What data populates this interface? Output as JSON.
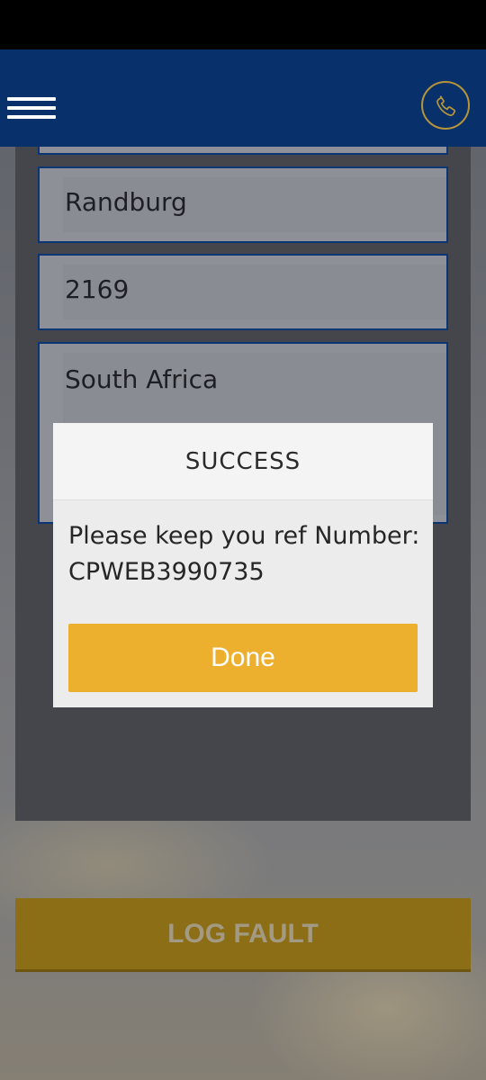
{
  "header": {
    "menu_icon": "hamburger-menu-icon",
    "phone_icon": "phone-icon"
  },
  "form": {
    "city": "Randburg",
    "postal_code": "2169",
    "country": "South Africa"
  },
  "log_fault_label": "LOG FAULT",
  "dialog": {
    "title": "SUCCESS",
    "message_line1": "Please keep you ref Number:",
    "message_line2": "CPWEB3990735",
    "done_label": "Done"
  },
  "colors": {
    "header": "#08306a",
    "accent_gold": "#ecb02e",
    "field_border": "#0b3574"
  }
}
